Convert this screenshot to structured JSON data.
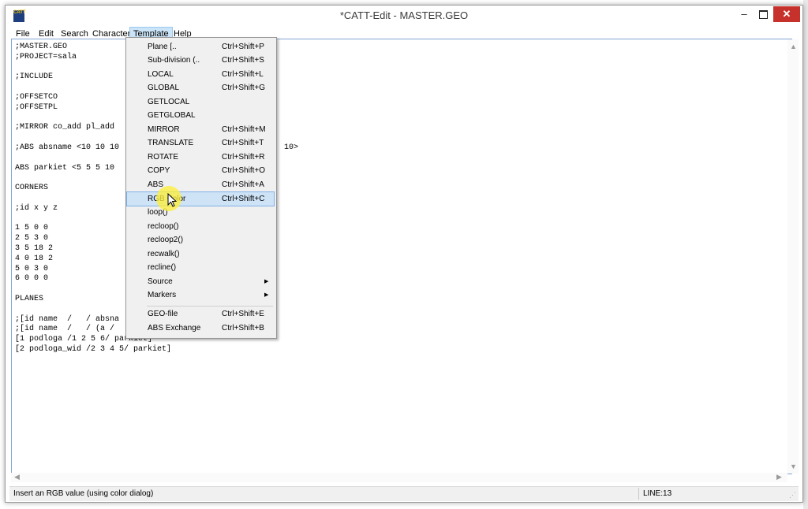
{
  "window": {
    "title": "*CATT-Edit - MASTER.GEO",
    "app_icon_text": "CATT"
  },
  "titlebar": {
    "minimize": "–",
    "close": "✕"
  },
  "menubar": {
    "items": [
      "File",
      "Edit",
      "Search",
      "Character",
      "Template",
      "Help"
    ],
    "active": "Template"
  },
  "editor": {
    "lines": [
      ";MASTER.GEO",
      ";PROJECT=sala",
      "",
      ";INCLUDE",
      "",
      ";OFFSETCO",
      ";OFFSETPL",
      "",
      ";MIRROR co_add pl_add",
      "",
      ";ABS absname <10 10 10 ",
      "",
      "ABS parkiet <5 5 5 10",
      "",
      "CORNERS",
      "",
      ";id x y z",
      "",
      "1 5 0 0",
      "2 5 3 0",
      "3 5 18 2",
      "4 0 18 2",
      "5 0 3 0",
      "6 0 0 0",
      "",
      "PLANES",
      "",
      ";[id name  /   / absna",
      ";[id name  /   / (a /",
      "[1 podloga /1 2 5 6/ parkiet]",
      "[2 podloga_wid /2 3 4 5/ parkiet]"
    ],
    "hidden_fragment": "10>"
  },
  "template_menu": [
    {
      "label": "Plane [..",
      "shortcut": "Ctrl+Shift+P"
    },
    {
      "label": "Sub-division (..",
      "shortcut": "Ctrl+Shift+S"
    },
    {
      "label": "LOCAL",
      "shortcut": "Ctrl+Shift+L"
    },
    {
      "label": "GLOBAL",
      "shortcut": "Ctrl+Shift+G"
    },
    {
      "label": "GETLOCAL",
      "shortcut": ""
    },
    {
      "label": "GETGLOBAL",
      "shortcut": ""
    },
    {
      "label": "MIRROR",
      "shortcut": "Ctrl+Shift+M"
    },
    {
      "label": "TRANSLATE",
      "shortcut": "Ctrl+Shift+T"
    },
    {
      "label": "ROTATE",
      "shortcut": "Ctrl+Shift+R"
    },
    {
      "label": "COPY",
      "shortcut": "Ctrl+Shift+O"
    },
    {
      "label": "ABS",
      "shortcut": "Ctrl+Shift+A"
    },
    {
      "label": "RGB Color",
      "shortcut": "Ctrl+Shift+C"
    },
    {
      "label": "loop()",
      "shortcut": ""
    },
    {
      "label": "recloop()",
      "shortcut": ""
    },
    {
      "label": "recloop2()",
      "shortcut": ""
    },
    {
      "label": "recwalk()",
      "shortcut": ""
    },
    {
      "label": "recline()",
      "shortcut": ""
    },
    {
      "label": "Source",
      "shortcut": ""
    },
    {
      "label": "Markers",
      "shortcut": ""
    },
    {
      "label": "GEO-file",
      "shortcut": "Ctrl+Shift+E"
    },
    {
      "label": "ABS Exchange",
      "shortcut": "Ctrl+Shift+B"
    }
  ],
  "submenu_arrow": "▶",
  "statusbar": {
    "text": "Insert an RGB value (using color dialog)",
    "line": "LINE:13"
  },
  "colors": {
    "highlight": "#cfe3f7",
    "active_menu": "#cce4f7",
    "close_button": "#c7312c"
  }
}
